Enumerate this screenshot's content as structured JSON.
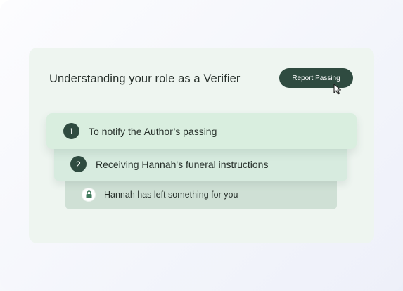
{
  "header": {
    "title": "Understanding your role as a Verifier",
    "report_button_label": "Report Passing"
  },
  "steps": [
    {
      "number": "1",
      "label": "To notify the Author’s passing"
    },
    {
      "number": "2",
      "label": "Receiving Hannah's funeral instructions"
    }
  ],
  "locked_item": {
    "icon": "lock-icon",
    "label": "Hannah has left something for you"
  },
  "colors": {
    "accent": "#2f4b40",
    "card_background": "#eef5f0",
    "step1_background": "#d9eedf",
    "step2_background": "#d7ebdf",
    "locked_background": "#cfe0d5"
  }
}
